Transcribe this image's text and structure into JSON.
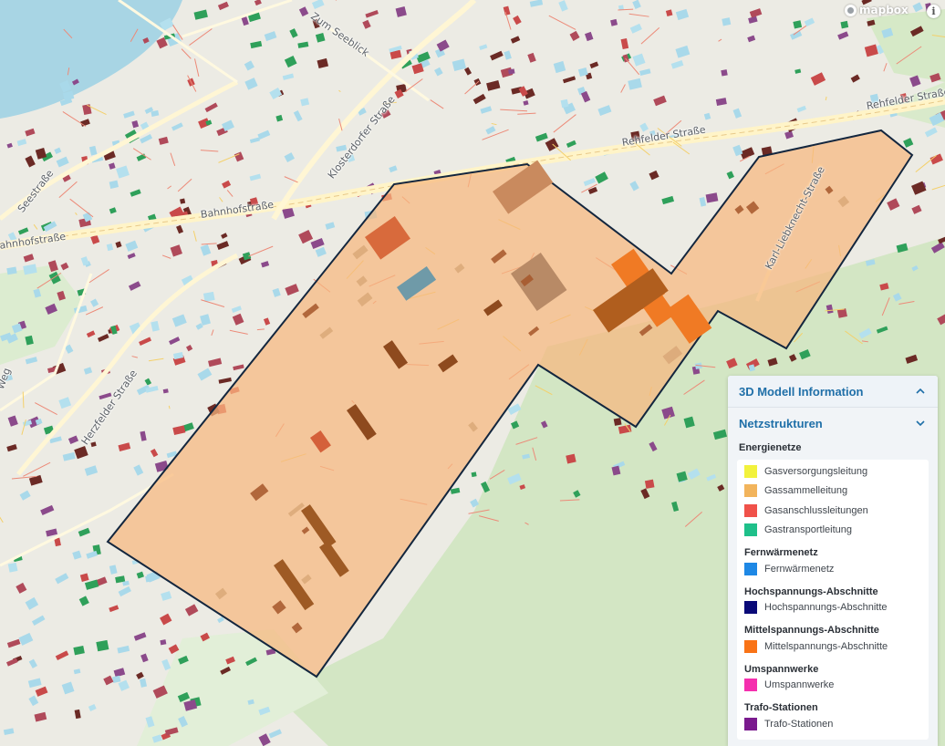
{
  "map": {
    "attribution_logo": "mapbox",
    "info_button": "i",
    "street_labels": [
      "Zum Seeblick",
      "Seestraße",
      "Klosterdorfer Straße",
      "Bahnhofstraße",
      "Bahnhofstraße",
      "Rehfelder Straße",
      "Rehfelder Straße",
      "Karl-Liebknecht-Straße",
      "Herzfelder Straße",
      "Weg"
    ],
    "colors": {
      "water": "#a8d5e4",
      "land": "#ecebe4",
      "park": "#d6e8c8",
      "highlight_area": "#f6b77e",
      "highlight_outline": "#13263e",
      "road_major": "#fdf3c4",
      "utility_line": "#e86a5a"
    }
  },
  "panel": {
    "title": "3D Modell Information",
    "section": "Netzstrukturen",
    "group": "Energienetze",
    "legend": [
      {
        "label": "Gasversorgungsleitung",
        "color": "#f2f23c"
      },
      {
        "label": "Gassammelleitung",
        "color": "#f2b45c"
      },
      {
        "label": "Gasanschlussleitungen",
        "color": "#f0524a"
      },
      {
        "label": "Gastransportleitung",
        "color": "#1fc08a"
      }
    ],
    "subgroups": [
      {
        "title": "Fernwärmenetz",
        "items": [
          {
            "label": "Fernwärmenetz",
            "color": "#1e88e5"
          }
        ]
      },
      {
        "title": "Hochspannungs-Abschnitte",
        "items": [
          {
            "label": "Hochspannungs-Abschnitte",
            "color": "#0a0a78"
          }
        ]
      },
      {
        "title": "Mittelspannungs-Abschnitte",
        "items": [
          {
            "label": "Mittelspannungs-Abschnitte",
            "color": "#f97316"
          }
        ]
      },
      {
        "title": "Umspannwerke",
        "items": [
          {
            "label": "Umspannwerke",
            "color": "#f52fae"
          }
        ]
      },
      {
        "title": "Trafo-Stationen",
        "items": [
          {
            "label": "Trafo-Stationen",
            "color": "#7a1a8e"
          }
        ]
      }
    ]
  }
}
